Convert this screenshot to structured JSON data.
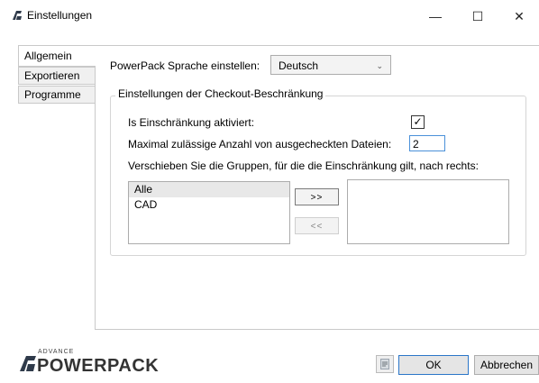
{
  "window": {
    "title": "Einstellungen",
    "minimize": "—",
    "maximize": "☐",
    "close": "✕",
    "app_icon": "advance-logo-icon"
  },
  "tabs": [
    {
      "label": "Allgemein",
      "active": true
    },
    {
      "label": "Exportieren",
      "active": false
    },
    {
      "label": "Programme",
      "active": false
    }
  ],
  "language": {
    "label": "PowerPack Sprache einstellen:",
    "value": "Deutsch"
  },
  "checkout": {
    "group_title": "Einstellungen der Checkout-Beschränkung",
    "enabled_label": "Is Einschränkung aktiviert:",
    "enabled": true,
    "max_files_label": "Maximal zulässige Anzahl von ausgecheckten Dateien:",
    "max_files_value": "2",
    "move_label": "Verschieben Sie die Gruppen, für die die Einschränkung gilt, nach rechts:",
    "available_groups": [
      "Alle",
      "CAD"
    ],
    "selected_groups": [],
    "move_right_label": ">>",
    "move_left_label": "<<"
  },
  "footer": {
    "logo_small": "ADVANCE",
    "logo_big": "POWERPACK",
    "ok_label": "OK",
    "cancel_label": "Abbrechen",
    "help_icon": "book-icon"
  },
  "colors": {
    "accent": "#2b76c8",
    "checkbox_border": "#333333"
  }
}
